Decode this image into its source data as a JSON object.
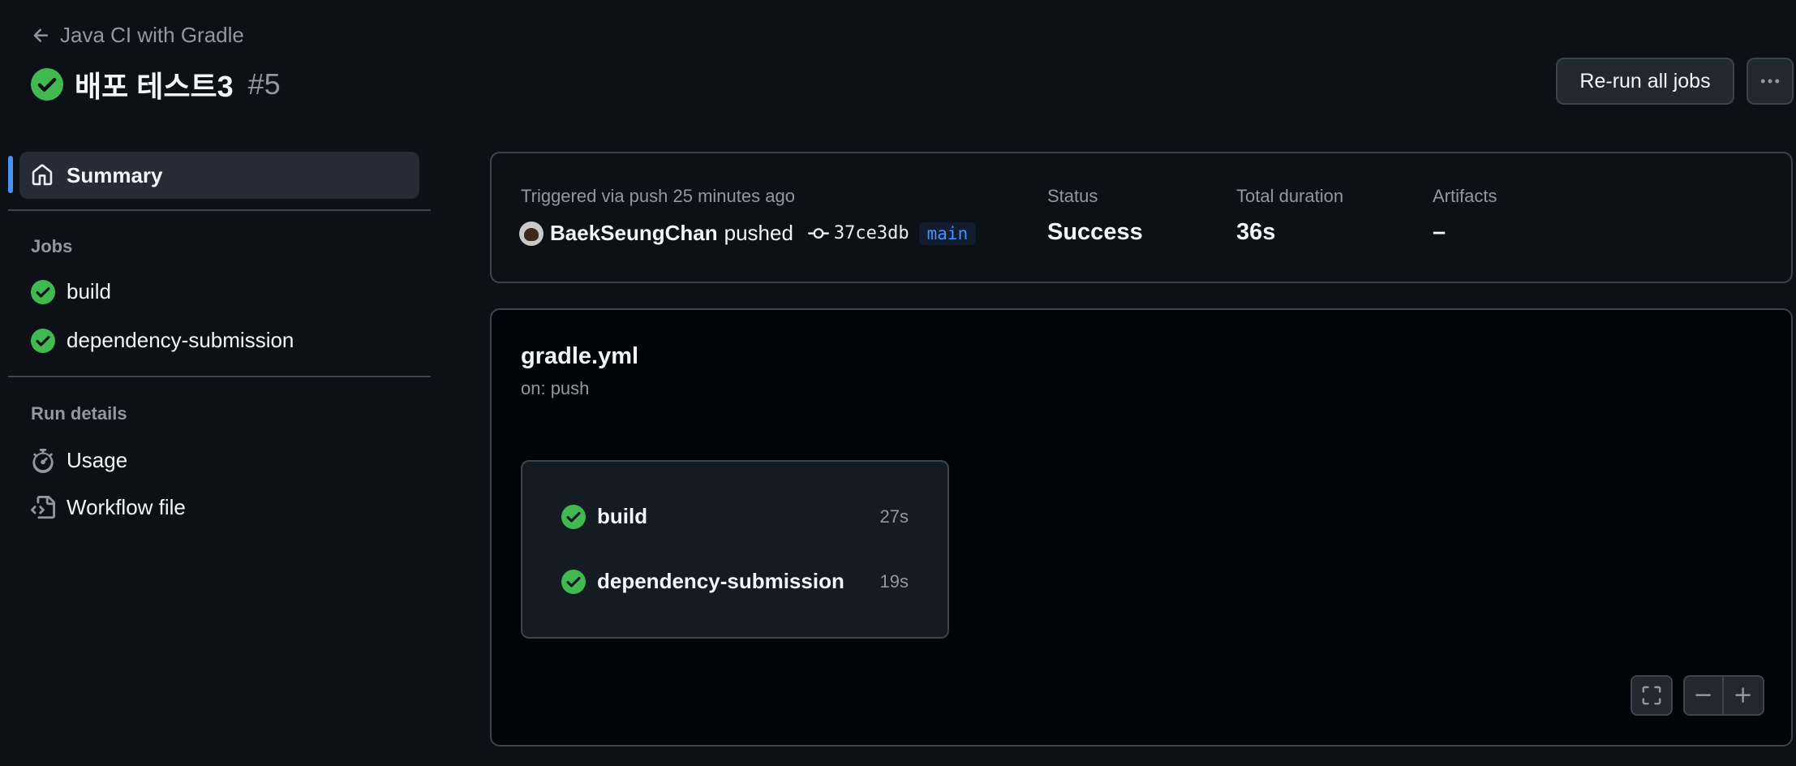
{
  "header": {
    "back_label": "Java CI with Gradle",
    "run_title": "배포 테스트3",
    "run_number": "#5",
    "rerun_label": "Re-run all jobs"
  },
  "sidebar": {
    "summary_label": "Summary",
    "jobs_heading": "Jobs",
    "jobs": [
      {
        "label": "build",
        "status": "success"
      },
      {
        "label": "dependency-submission",
        "status": "success"
      }
    ],
    "run_details_heading": "Run details",
    "details": [
      {
        "label": "Usage",
        "icon": "stopwatch-icon"
      },
      {
        "label": "Workflow file",
        "icon": "file-code-icon"
      }
    ]
  },
  "summary": {
    "triggered_label": "Triggered via push 25 minutes ago",
    "actor": "BaekSeungChan",
    "action": "pushed",
    "commit": "37ce3db",
    "branch": "main",
    "status_label": "Status",
    "status_value": "Success",
    "duration_label": "Total duration",
    "duration_value": "36s",
    "artifacts_label": "Artifacts",
    "artifacts_value": "–"
  },
  "workflow": {
    "file": "gradle.yml",
    "trigger": "on: push",
    "jobs": [
      {
        "name": "build",
        "duration": "27s"
      },
      {
        "name": "dependency-submission",
        "duration": "19s"
      }
    ]
  },
  "colors": {
    "success": "#3fb950",
    "accent": "#4493f8",
    "background": "#0d1117"
  }
}
